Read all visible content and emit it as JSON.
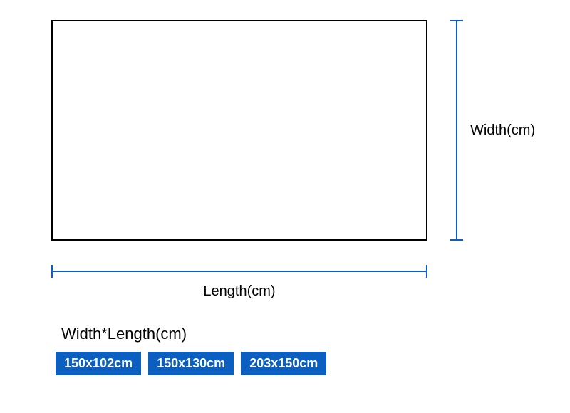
{
  "labels": {
    "width": "Width(cm)",
    "length": "Length(cm)",
    "options_title": "Width*Length(cm)"
  },
  "size_options": [
    {
      "label": "150x102cm"
    },
    {
      "label": "150x130cm"
    },
    {
      "label": "203x150cm"
    }
  ],
  "colors": {
    "accent": "#0a5fc1"
  }
}
